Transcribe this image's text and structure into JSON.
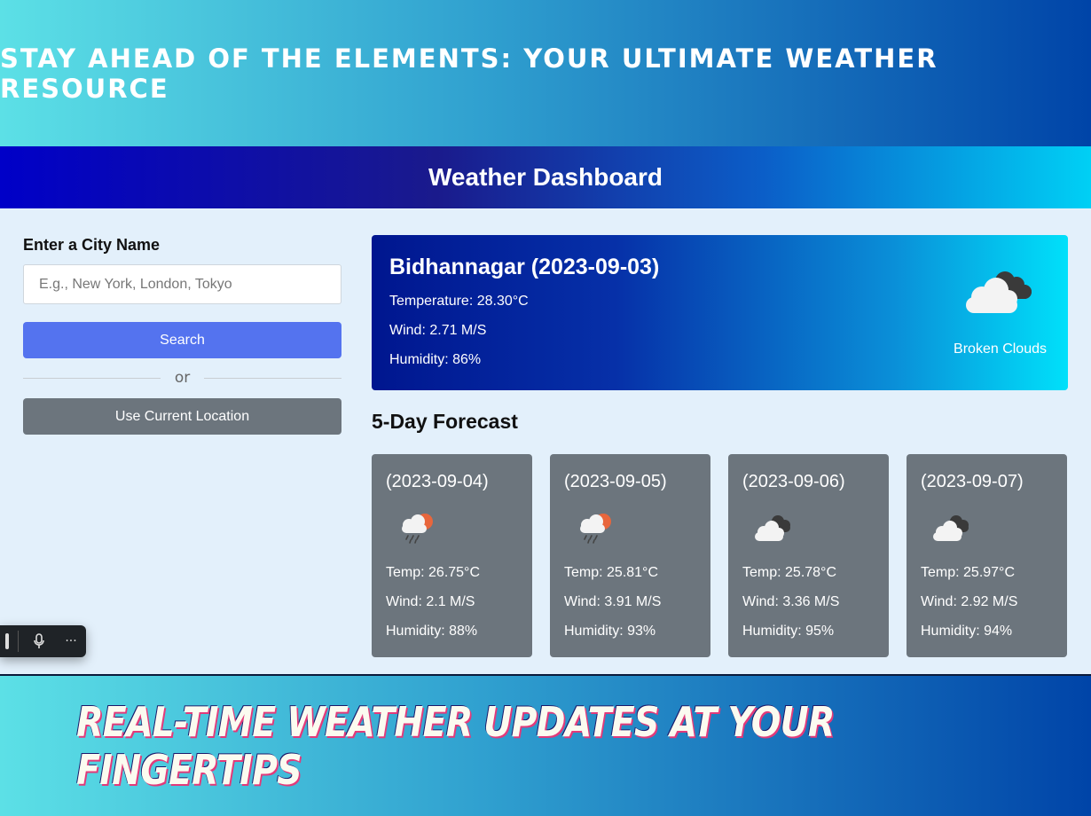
{
  "banner": {
    "top_title": "Stay Ahead of the Elements: Your Ultimate Weather Resource",
    "bottom_title": "Real-Time Weather Updates at Your Fingertips"
  },
  "header": {
    "title": "Weather Dashboard"
  },
  "search": {
    "label": "Enter a City Name",
    "placeholder": "E.g., New York, London, Tokyo",
    "value": "",
    "search_button": "Search",
    "separator": "or",
    "location_button": "Use Current Location"
  },
  "current": {
    "title": "Bidhannagar (2023-09-03)",
    "temperature": "Temperature: 28.30°C",
    "wind": "Wind: 2.71 M/S",
    "humidity": "Humidity: 86%",
    "description": "Broken Clouds",
    "icon": "broken-clouds-icon"
  },
  "forecast": {
    "title": "5-Day Forecast",
    "days": [
      {
        "date": "(2023-09-04)",
        "icon": "light-rain-icon",
        "temp": "Temp: 26.75°C",
        "wind": "Wind: 2.1 M/S",
        "humidity": "Humidity: 88%"
      },
      {
        "date": "(2023-09-05)",
        "icon": "light-rain-icon",
        "temp": "Temp: 25.81°C",
        "wind": "Wind: 3.91 M/S",
        "humidity": "Humidity: 93%"
      },
      {
        "date": "(2023-09-06)",
        "icon": "broken-clouds-icon",
        "temp": "Temp: 25.78°C",
        "wind": "Wind: 3.36 M/S",
        "humidity": "Humidity: 95%"
      },
      {
        "date": "(2023-09-07)",
        "icon": "broken-clouds-icon",
        "temp": "Temp: 25.97°C",
        "wind": "Wind: 2.92 M/S",
        "humidity": "Humidity: 94%"
      }
    ]
  },
  "toolbar": {
    "icons": [
      "microphone-icon",
      "more-icon"
    ]
  },
  "colors": {
    "search_button": "#5473ef",
    "location_button": "#6c757d",
    "forecast_card": "#6c757d",
    "page_background": "#e3f0fb"
  }
}
